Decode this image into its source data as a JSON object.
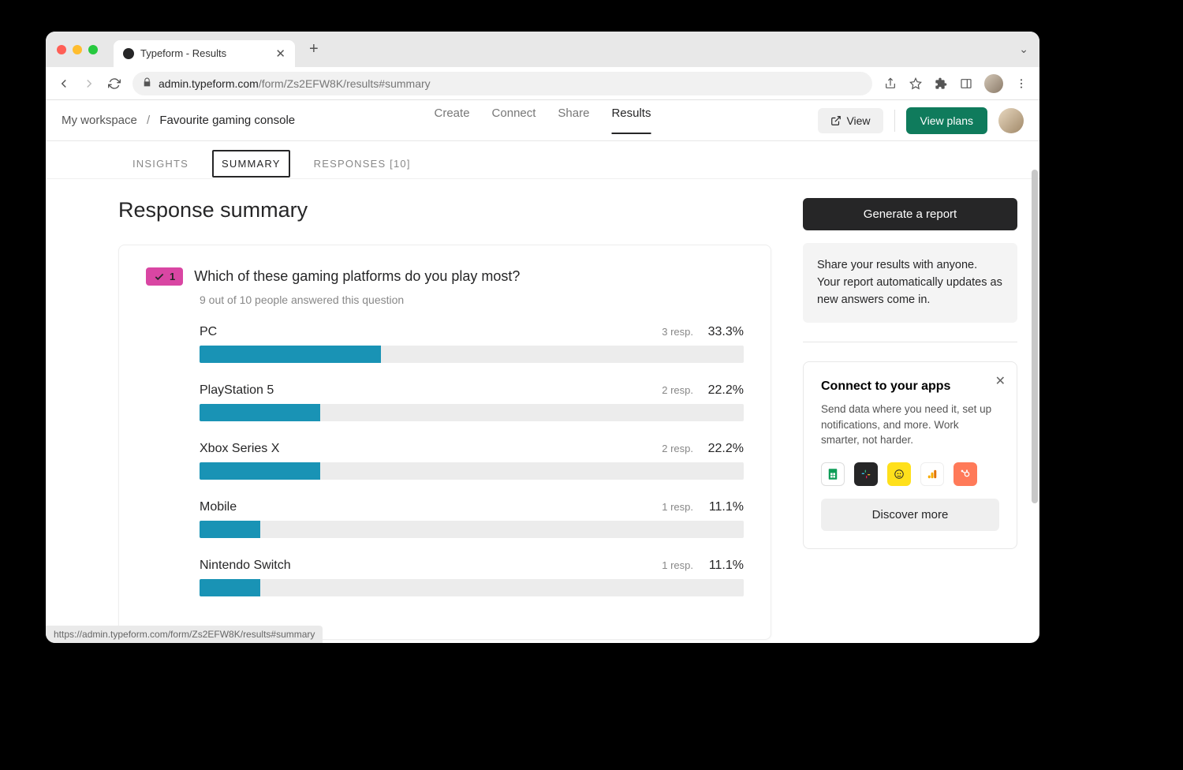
{
  "browser": {
    "tab_title": "Typeform - Results",
    "url_host": "admin.typeform.com",
    "url_path": "/form/Zs2EFW8K/results#summary",
    "status_url": "https://admin.typeform.com/form/Zs2EFW8K/results#summary"
  },
  "header": {
    "workspace": "My workspace",
    "form_name": "Favourite gaming console",
    "nav": {
      "create": "Create",
      "connect": "Connect",
      "share": "Share",
      "results": "Results"
    },
    "view_btn": "View",
    "plans_btn": "View plans"
  },
  "tabs": {
    "insights": "INSIGHTS",
    "summary": "SUMMARY",
    "responses": "RESPONSES [10]"
  },
  "page_title": "Response summary",
  "question": {
    "number": "1",
    "title": "Which of these gaming platforms do you play most?",
    "subtext": "9 out of 10 people answered this question"
  },
  "chart_data": {
    "type": "bar",
    "categories": [
      "PC",
      "PlayStation 5",
      "Xbox Series X",
      "Mobile",
      "Nintendo Switch"
    ],
    "series": [
      {
        "name": "Responses",
        "values": [
          3,
          2,
          2,
          1,
          1
        ]
      }
    ],
    "percent": [
      33.3,
      22.2,
      22.2,
      11.1,
      11.1
    ],
    "resp_labels": [
      "3 resp.",
      "2 resp.",
      "2 resp.",
      "1 resp.",
      "1 resp."
    ],
    "pct_labels": [
      "33.3%",
      "22.2%",
      "22.2%",
      "11.1%",
      "11.1%"
    ],
    "total_answered": 9,
    "total_asked": 10
  },
  "sidebar": {
    "report_btn": "Generate a report",
    "share_text": "Share your results with anyone. Your report automatically updates as new answers come in.",
    "connect": {
      "title": "Connect to your apps",
      "desc": "Send data where you need it, set up notifications, and more. Work smarter, not harder.",
      "discover_btn": "Discover more"
    }
  }
}
